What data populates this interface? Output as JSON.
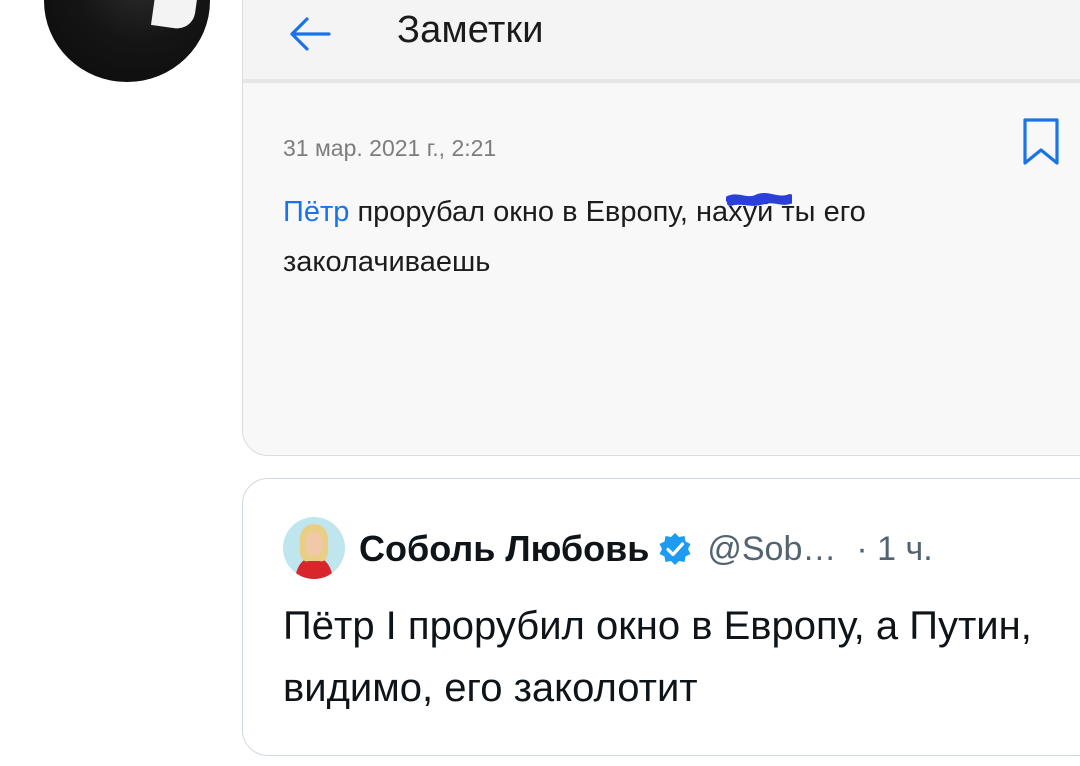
{
  "notes_app": {
    "title": "Заметки",
    "date": "31 мар. 2021 г., 2:21",
    "note": {
      "link_word": "Пётр",
      "text_part1": " прорубал окно в Европу, на",
      "redacted": "хуй",
      "text_part2": " ты его заколачиваешь"
    },
    "accent_color": "#1a73e8"
  },
  "quoted_tweet": {
    "author": "Соболь Любовь",
    "handle": "@Sob…",
    "time": "· 1 ч.",
    "verified": true,
    "text": "Пётр I прорубил окно в Европу, а Путин, видимо, его заколотит",
    "verified_color": "#1d9bf0"
  },
  "icons": [
    "back-arrow-icon",
    "bookmark-icon",
    "verified-badge-icon",
    "user-avatar"
  ]
}
